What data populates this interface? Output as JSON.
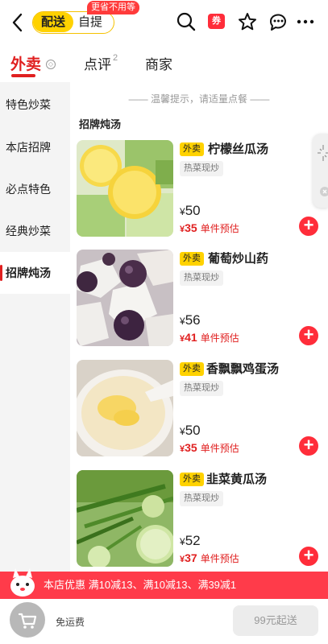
{
  "topbar": {
    "mode_active": "配送",
    "mode_inactive": "自提",
    "mode_tag": "更省不用等",
    "coupon_label": "券"
  },
  "tabs": [
    {
      "label": "外卖",
      "active": true
    },
    {
      "label": "点评",
      "sup": "2"
    },
    {
      "label": "商家"
    }
  ],
  "sidebar": {
    "items": [
      {
        "label": "特色炒菜"
      },
      {
        "label": "本店招牌"
      },
      {
        "label": "必点特色"
      },
      {
        "label": "经典炒菜"
      },
      {
        "label": "招牌炖汤",
        "active": true
      }
    ]
  },
  "content": {
    "tip": "—— 温馨提示，请适量点餐 ——",
    "category_title": "招牌炖汤",
    "dishes": [
      {
        "badge": "外卖",
        "name": "柠檬丝瓜汤",
        "tag": "热菜现炒",
        "price_symbol": "¥",
        "price": "50",
        "est_symbol": "¥",
        "est_price": "35",
        "est_label": "单件预估"
      },
      {
        "badge": "外卖",
        "name": "葡萄炒山药",
        "tag": "热菜现炒",
        "price_symbol": "¥",
        "price": "56",
        "est_symbol": "¥",
        "est_price": "41",
        "est_label": "单件预估"
      },
      {
        "badge": "外卖",
        "name": "香飘飘鸡蛋汤",
        "tag": "热菜现炒",
        "price_symbol": "¥",
        "price": "50",
        "est_symbol": "¥",
        "est_price": "35",
        "est_label": "单件预估"
      },
      {
        "badge": "外卖",
        "name": "韭菜黄瓜汤",
        "tag": "热菜现炒",
        "price_symbol": "¥",
        "price": "52",
        "est_symbol": "¥",
        "est_price": "37",
        "est_label": "单件预估"
      }
    ]
  },
  "promo": {
    "text": "本店优惠  满10减13、满10减13、满39减1"
  },
  "bottom": {
    "free_delivery": "免运费",
    "checkout": "99元起送"
  },
  "colors": {
    "brand_yellow": "#ffd200",
    "accent_red": "#e02020",
    "promo_red": "#ff3b4a"
  }
}
